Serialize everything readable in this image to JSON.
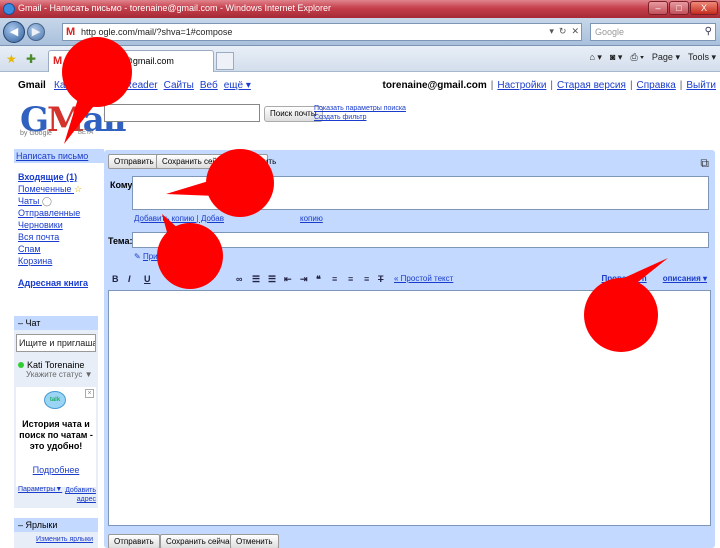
{
  "window": {
    "title": "Gmail - Написать письмо - torenaine@gmail.com - Windows Internet Explorer",
    "controls": [
      "–",
      "□",
      "X"
    ]
  },
  "browser": {
    "url": "http://mail.google.com/mail/?shva=1#compose",
    "url_visible": "http         ogle.com/mail/?shva=1#compose",
    "search_placeholder": "Google",
    "tab_title": "Gmail - Написать письмо - torenaine@gmail.com",
    "tab_title_visible": "мо - torenaine@gmail.com",
    "toolbar_right": {
      "page": "Page ▾",
      "tools": "Tools ▾"
    }
  },
  "gbar": {
    "brand": "Gmail",
    "links": [
      "Календарь",
      "Reader",
      "Сайты",
      "Веб",
      "ещё ▾"
    ],
    "links_visible": [
      "Кале",
      "Reader",
      "Сайты",
      "Веб",
      "ещё ▾"
    ],
    "email": "torenaine@gmail.com",
    "right_links": [
      "Настройки",
      "Старая версия",
      "Справка",
      "Выйти"
    ]
  },
  "logo": {
    "by": "by Google",
    "beta": "BETA"
  },
  "search": {
    "button": "Поиск почты",
    "options": [
      "Показать параметры поиска",
      "Создать фильтр"
    ]
  },
  "sidebar": {
    "compose": "Написать письмо",
    "folders": [
      {
        "label": "Входящие (1)",
        "bold": true
      },
      {
        "label": "Помеченные",
        "icon": "star-icon"
      },
      {
        "label": "Чаты",
        "icon": "chat-bubble-icon"
      },
      {
        "label": "Отправленные"
      },
      {
        "label": "Черновики"
      },
      {
        "label": "Вся почта"
      },
      {
        "label": "Спам"
      },
      {
        "label": "Корзина"
      }
    ],
    "address_book": "Адресная книга"
  },
  "chat": {
    "header": "– Чат",
    "search": "Ищите и приглашайте",
    "user": "Kati Torenaine",
    "status": "Укажите статус ▼",
    "promo_icon": "talk",
    "promo_text": "История чата и поиск по чатам - это удобно!",
    "promo_more": "Подробнее",
    "links": {
      "params": "Параметры▼",
      "add": "Добавить адрес"
    }
  },
  "labels": {
    "header": "– Ярлыки",
    "edit": "Изменить ярлыки"
  },
  "compose": {
    "buttons": {
      "send": "Отправить",
      "save": "Сохранить сейчас",
      "discard": "Отменить"
    },
    "top_discard_visible": "нить",
    "to_label": "Кому:",
    "cc_links": [
      "Добавить копию",
      "Добавить скрытую копию"
    ],
    "cc_visible_1": "Доб",
    "cc_visible_2": "авить копию | Добав",
    "cc_visible_3": "копию",
    "subject_label": "Тема:",
    "attach": "Прикрепить файл",
    "attach_visible": "При",
    "format_tools": [
      "B",
      "I",
      "U"
    ],
    "format_tools_right": [
      "∞",
      "☰",
      "☰",
      "⇤",
      "⇥",
      "❝",
      "≡",
      "≡",
      "≡",
      "T"
    ],
    "plain_text": "« Простой текст",
    "spellcheck": "Проверка правописания ▾",
    "spellcheck_visible_1": "Проверка п",
    "spellcheck_visible_2": "описания ▾"
  },
  "annotation_color": "#ff0000"
}
